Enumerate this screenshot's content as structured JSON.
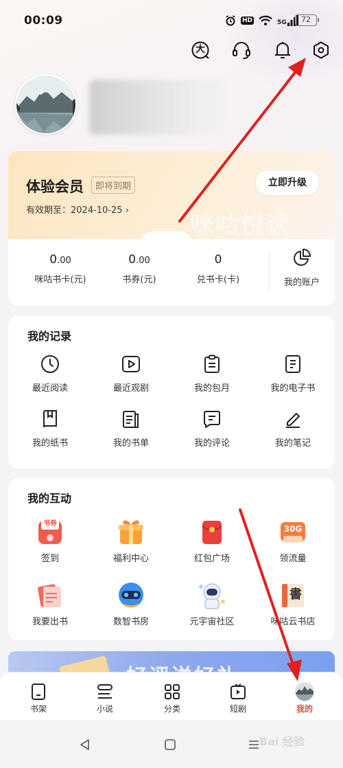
{
  "status_bar": {
    "time": "00:09",
    "hd_label": "HD",
    "network_label": "5G",
    "battery": "72"
  },
  "header_icons": [
    "font-size-icon",
    "customer-service-icon",
    "bell-icon",
    "settings-icon"
  ],
  "header": {
    "font_size_glyph": "大"
  },
  "vip": {
    "title": "体验会员",
    "badge": "即将到期",
    "expiry": "有效期至：2024-10-25 ›",
    "upgrade_label": "立即升级",
    "watermark": "咪咕悦读"
  },
  "stats": [
    {
      "value": "0",
      "decimals": ".00",
      "label": "咪咕书卡(元)"
    },
    {
      "value": "0",
      "decimals": ".00",
      "label": "书券(元)"
    },
    {
      "value": "0",
      "decimals": "",
      "label": "兑书卡(卡)"
    }
  ],
  "account_label": "我的账户",
  "records": {
    "title": "我的记录",
    "items": [
      {
        "label": "最近阅读",
        "icon": "clock-icon"
      },
      {
        "label": "最近观剧",
        "icon": "video-play-icon"
      },
      {
        "label": "我的包月",
        "icon": "clipboard-icon"
      },
      {
        "label": "我的电子书",
        "icon": "ebook-icon"
      },
      {
        "label": "我的纸书",
        "icon": "paper-book-icon"
      },
      {
        "label": "我的书单",
        "icon": "booklist-icon"
      },
      {
        "label": "我的评论",
        "icon": "comment-icon"
      },
      {
        "label": "我的笔记",
        "icon": "pen-note-icon"
      }
    ]
  },
  "interaction": {
    "title": "我的互动",
    "checkin_glyph": "书券",
    "traffic_glyph": "30G",
    "bookstore_glyph": "書",
    "items": [
      {
        "label": "签到",
        "icon": "checkin-coupon-icon"
      },
      {
        "label": "福利中心",
        "icon": "gift-box-icon"
      },
      {
        "label": "红包广场",
        "icon": "red-envelope-icon"
      },
      {
        "label": "领流量",
        "icon": "data-traffic-icon"
      },
      {
        "label": "我要出书",
        "icon": "publish-book-icon"
      },
      {
        "label": "数智书房",
        "icon": "vr-headset-icon"
      },
      {
        "label": "元宇宙社区",
        "icon": "astronaut-icon"
      },
      {
        "label": "咪咕云书店",
        "icon": "cloud-bookstore-icon"
      }
    ]
  },
  "promo": {
    "text": "好评送好礼"
  },
  "tabbar": {
    "items": [
      {
        "label": "书架",
        "icon": "bookshelf-icon"
      },
      {
        "label": "小说",
        "icon": "novel-icon"
      },
      {
        "label": "分类",
        "icon": "category-grid-icon"
      },
      {
        "label": "短剧",
        "icon": "short-drama-icon"
      },
      {
        "label": "我的",
        "icon": "profile-avatar-icon"
      }
    ],
    "active_index": 4
  },
  "watermark": {
    "text": "Bai 经验"
  },
  "colors": {
    "accent_red": "#e8473f",
    "vip_gold": "#fbe6bf",
    "annotation_arrow": "#e02020"
  }
}
